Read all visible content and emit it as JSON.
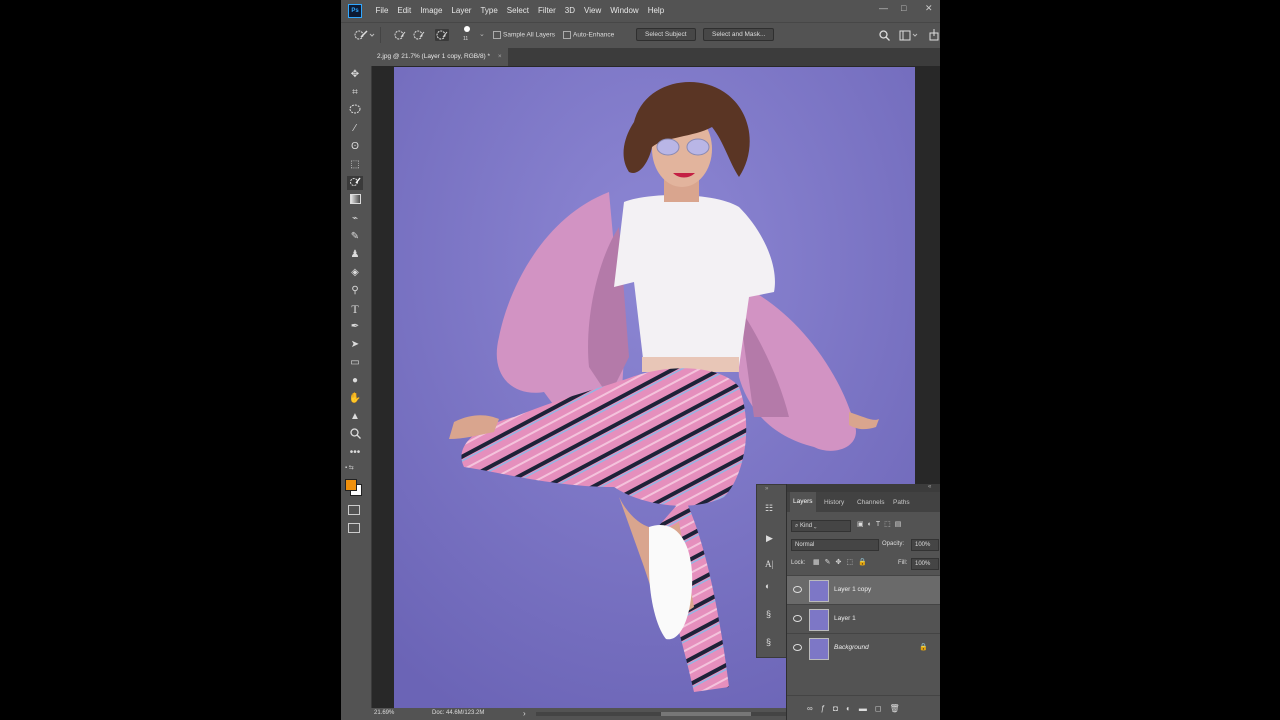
{
  "app": {
    "logo": "Ps"
  },
  "menu": [
    "File",
    "Edit",
    "Image",
    "Layer",
    "Type",
    "Select",
    "Filter",
    "3D",
    "View",
    "Window",
    "Help"
  ],
  "window_controls": {
    "minimize": "—",
    "maximize": "□",
    "close": "✕"
  },
  "options": {
    "brush_size": "11",
    "sample_all_layers": "Sample All Layers",
    "auto_enhance": "Auto-Enhance",
    "select_subject": "Select Subject",
    "select_and_mask": "Select and Mask..."
  },
  "document": {
    "tab_title": "2.jpg @ 21.7% (Layer 1 copy, RGB/8) *",
    "tab_close": "×"
  },
  "status": {
    "zoom": "21.69%",
    "doc": "Doc: 44.6M/123.2M",
    "arrow": "›"
  },
  "colors": {
    "foreground": "#f0900c",
    "background": "#ffffff",
    "canvas_bg": "#7d77c6"
  },
  "tools": [
    "move-icon",
    "crop-icon",
    "marquee-icon",
    "eyedropper-icon",
    "lasso-icon",
    "object-select-icon",
    "quick-select-icon",
    "gradient-icon",
    "healing-brush-icon",
    "brush-icon",
    "clone-stamp-icon",
    "eraser-icon",
    "history-brush-icon",
    "type-icon",
    "pen-icon",
    "path-select-icon",
    "rectangle-icon",
    "blur-icon",
    "hand-icon",
    "sharpen-icon",
    "zoom-icon",
    "more-icon"
  ],
  "layers_panel": {
    "tabs": [
      "Layers",
      "History",
      "Channels",
      "Paths"
    ],
    "filter_kind": "Kind",
    "blend_mode": "Normal",
    "opacity_label": "Opacity:",
    "opacity_value": "100%",
    "lock_label": "Lock:",
    "fill_label": "Fill:",
    "fill_value": "100%",
    "layers": [
      {
        "name": "Layer 1 copy",
        "selected": true
      },
      {
        "name": "Layer 1",
        "selected": false
      },
      {
        "name": "Background",
        "selected": false,
        "locked": true
      }
    ]
  }
}
